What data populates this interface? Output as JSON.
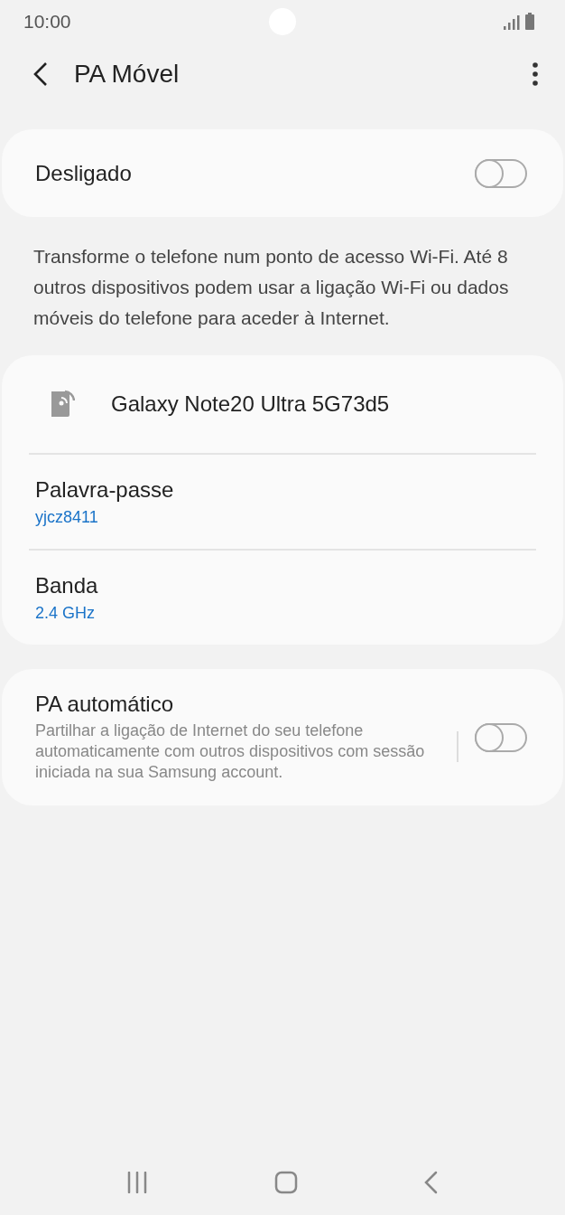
{
  "status_bar": {
    "time": "10:00"
  },
  "header": {
    "title": "PA Móvel"
  },
  "master_switch": {
    "label": "Desligado",
    "on": false
  },
  "description": "Transforme o telefone num ponto de acesso Wi-Fi. Até 8 outros dispositivos podem usar a ligação Wi-Fi ou dados móveis do telefone para aceder à Internet.",
  "network": {
    "name": "Galaxy Note20 Ultra 5G73d5",
    "settings": [
      {
        "label": "Palavra-passe",
        "value": "yjcz8411"
      },
      {
        "label": "Banda",
        "value": "2.4 GHz"
      }
    ]
  },
  "auto_hotspot": {
    "title": "PA automático",
    "summary": "Partilhar a ligação de Internet do seu telefone automaticamente com outros dispositivos com sessão iniciada na sua Samsung account.",
    "on": false
  }
}
